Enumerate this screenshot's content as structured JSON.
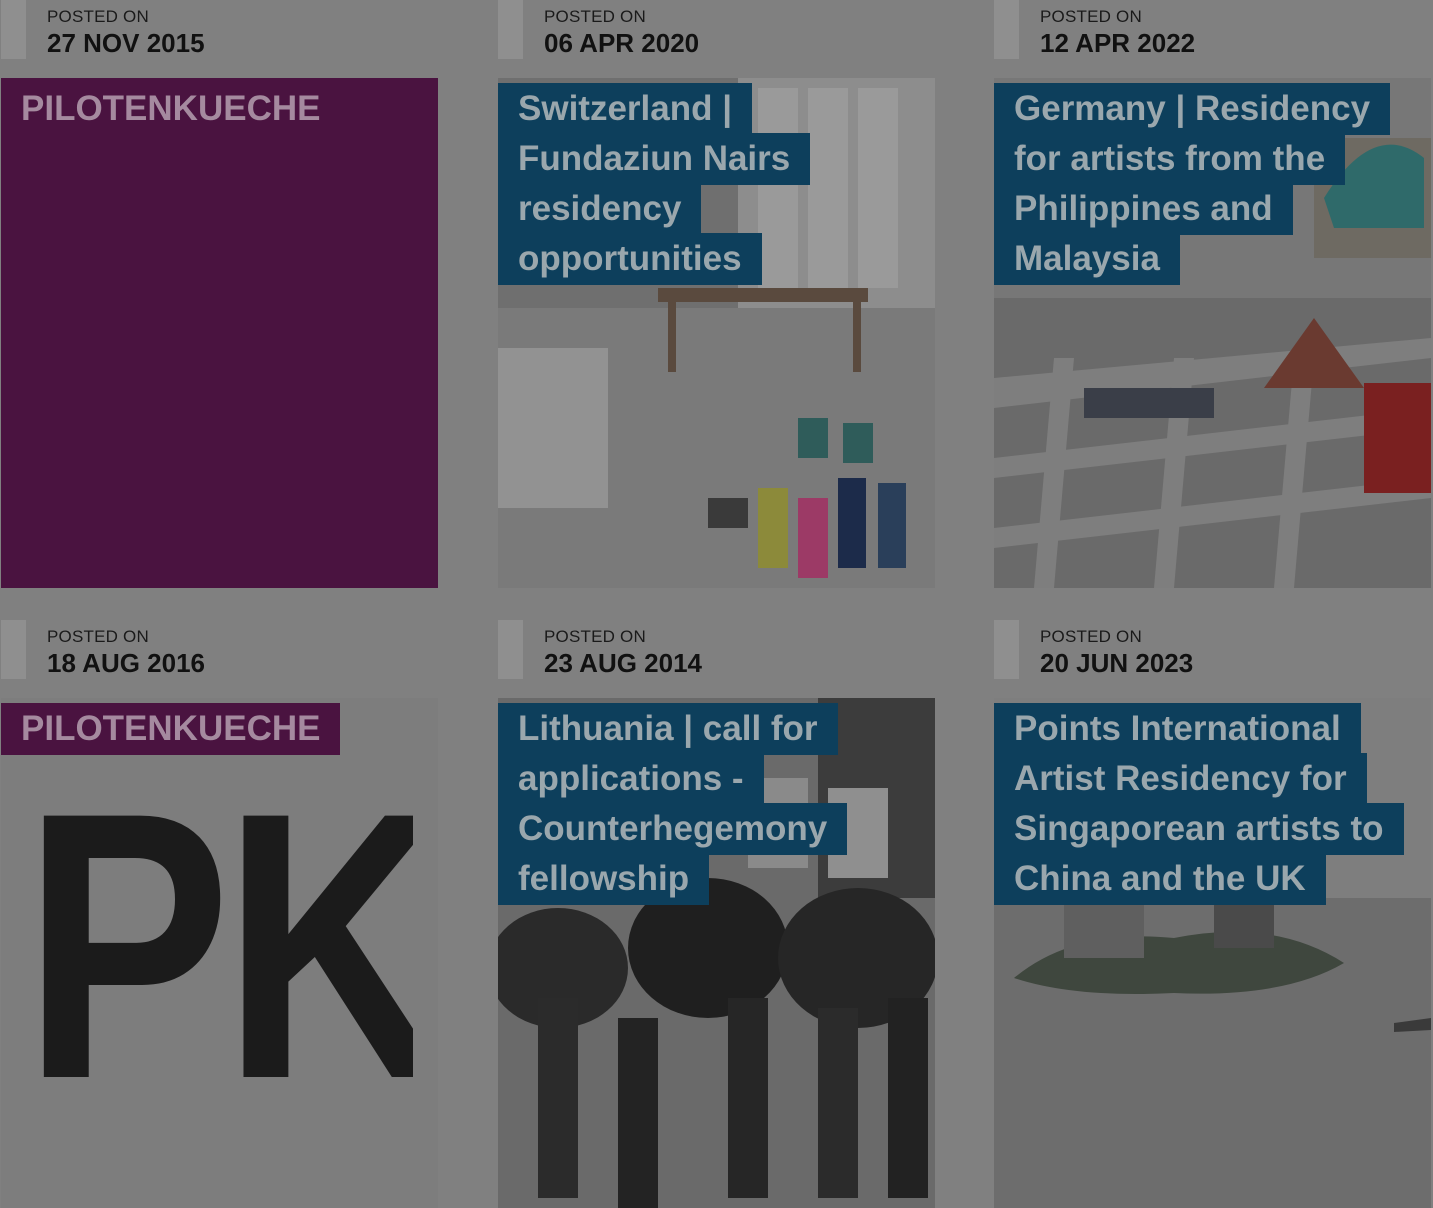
{
  "posted_label": "POSTED ON",
  "cards": [
    {
      "date": "27 NOV 2015",
      "title": "PILOTENKUECHE",
      "image": "purple-placeholder"
    },
    {
      "date": "06 APR 2020",
      "title": "Switzerland | Fundaziun Nairs residency opportunities",
      "image": "studio-photo"
    },
    {
      "date": "12 APR 2022",
      "title": "Germany | Residency for artists from the Philippines and Malaysia",
      "image": "studio-floor-photo"
    },
    {
      "date": "18 AUG 2016",
      "title": "PILOTENKUECHE",
      "image": "pk-logo",
      "logo_text": "PK"
    },
    {
      "date": "23 AUG 2014",
      "title": "Lithuania | call for applications - Counterhegemony fellowship",
      "image": "crowd-photo"
    },
    {
      "date": "20 JUN 2023",
      "title": "Points International Artist Residency for Singaporean artists to China and the UK",
      "image": "island-photo"
    }
  ],
  "colors": {
    "page_overlay": "#808080",
    "title_blue": "#0d3f5c",
    "title_purple": "#4a1340"
  }
}
